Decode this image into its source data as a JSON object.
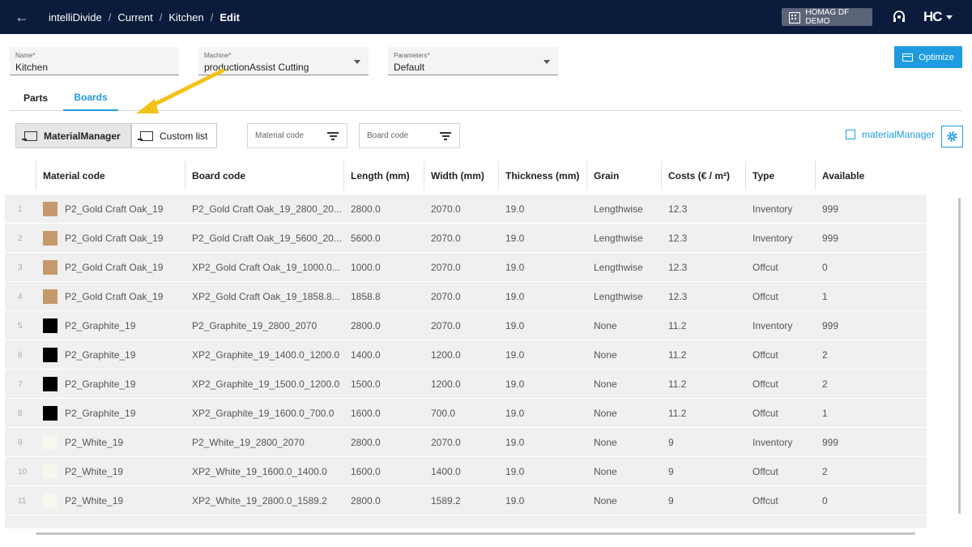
{
  "breadcrumb": [
    "intelliDivide",
    "Current",
    "Kitchen",
    "Edit"
  ],
  "tenant": "HOMAG DF DEMO",
  "logo": "HC",
  "form": {
    "name_label": "Name*",
    "name_value": "Kitchen",
    "machine_label": "Machine*",
    "machine_value": "productionAssist Cutting",
    "parameters_label": "Parameters*",
    "parameters_value": "Default"
  },
  "optimize_label": "Optimize",
  "tabs": [
    "Parts",
    "Boards"
  ],
  "active_tab": "Boards",
  "source_buttons": [
    "MaterialManager",
    "Custom list"
  ],
  "filters": {
    "material_code": "Material code",
    "board_code": "Board code"
  },
  "material_manager_link": "materialManager",
  "columns": [
    "Material code",
    "Board code",
    "Length (mm)",
    "Width (mm)",
    "Thickness (mm)",
    "Grain",
    "Costs (€ / m²)",
    "Type",
    "Available"
  ],
  "rows": [
    {
      "n": "1",
      "material": "P2_Gold Craft Oak_19",
      "board": "P2_Gold Craft Oak_19_2800_20...",
      "length": "2800.0",
      "width": "2070.0",
      "thickness": "19.0",
      "grain": "Lengthwise",
      "costs": "12.3",
      "type": "Inventory",
      "available": "999",
      "swatch": "#c49a6c"
    },
    {
      "n": "2",
      "material": "P2_Gold Craft Oak_19",
      "board": "P2_Gold Craft Oak_19_5600_20...",
      "length": "5600.0",
      "width": "2070.0",
      "thickness": "19.0",
      "grain": "Lengthwise",
      "costs": "12.3",
      "type": "Inventory",
      "available": "999",
      "swatch": "#c49a6c"
    },
    {
      "n": "3",
      "material": "P2_Gold Craft Oak_19",
      "board": "XP2_Gold Craft Oak_19_1000.0...",
      "length": "1000.0",
      "width": "2070.0",
      "thickness": "19.0",
      "grain": "Lengthwise",
      "costs": "12.3",
      "type": "Offcut",
      "available": "0",
      "swatch": "#c49a6c"
    },
    {
      "n": "4",
      "material": "P2_Gold Craft Oak_19",
      "board": "XP2_Gold Craft Oak_19_1858.8...",
      "length": "1858.8",
      "width": "2070.0",
      "thickness": "19.0",
      "grain": "Lengthwise",
      "costs": "12.3",
      "type": "Offcut",
      "available": "1",
      "swatch": "#c49a6c"
    },
    {
      "n": "5",
      "material": "P2_Graphite_19",
      "board": "P2_Graphite_19_2800_2070",
      "length": "2800.0",
      "width": "2070.0",
      "thickness": "19.0",
      "grain": "None",
      "costs": "11.2",
      "type": "Inventory",
      "available": "999",
      "swatch": "#000000"
    },
    {
      "n": "6",
      "material": "P2_Graphite_19",
      "board": "XP2_Graphite_19_1400.0_1200.0",
      "length": "1400.0",
      "width": "1200.0",
      "thickness": "19.0",
      "grain": "None",
      "costs": "11.2",
      "type": "Offcut",
      "available": "2",
      "swatch": "#000000"
    },
    {
      "n": "7",
      "material": "P2_Graphite_19",
      "board": "XP2_Graphite_19_1500.0_1200.0",
      "length": "1500.0",
      "width": "1200.0",
      "thickness": "19.0",
      "grain": "None",
      "costs": "11.2",
      "type": "Offcut",
      "available": "2",
      "swatch": "#000000"
    },
    {
      "n": "8",
      "material": "P2_Graphite_19",
      "board": "XP2_Graphite_19_1600.0_700.0",
      "length": "1600.0",
      "width": "700.0",
      "thickness": "19.0",
      "grain": "None",
      "costs": "11.2",
      "type": "Offcut",
      "available": "1",
      "swatch": "#000000"
    },
    {
      "n": "9",
      "material": "P2_White_19",
      "board": "P2_White_19_2800_2070",
      "length": "2800.0",
      "width": "2070.0",
      "thickness": "19.0",
      "grain": "None",
      "costs": "9",
      "type": "Inventory",
      "available": "999",
      "swatch": "#f7f7ef"
    },
    {
      "n": "10",
      "material": "P2_White_19",
      "board": "XP2_White_19_1600.0_1400.0",
      "length": "1600.0",
      "width": "1400.0",
      "thickness": "19.0",
      "grain": "None",
      "costs": "9",
      "type": "Offcut",
      "available": "2",
      "swatch": "#f7f7ef"
    },
    {
      "n": "11",
      "material": "P2_White_19",
      "board": "XP2_White_19_2800.0_1589.2",
      "length": "2800.0",
      "width": "1589.2",
      "thickness": "19.0",
      "grain": "None",
      "costs": "9",
      "type": "Offcut",
      "available": "0",
      "swatch": "#f7f7ef"
    }
  ],
  "colors": {
    "topbar": "#0b1b3b",
    "accent": "#1e9be0",
    "arrow": "#f2c21b"
  }
}
